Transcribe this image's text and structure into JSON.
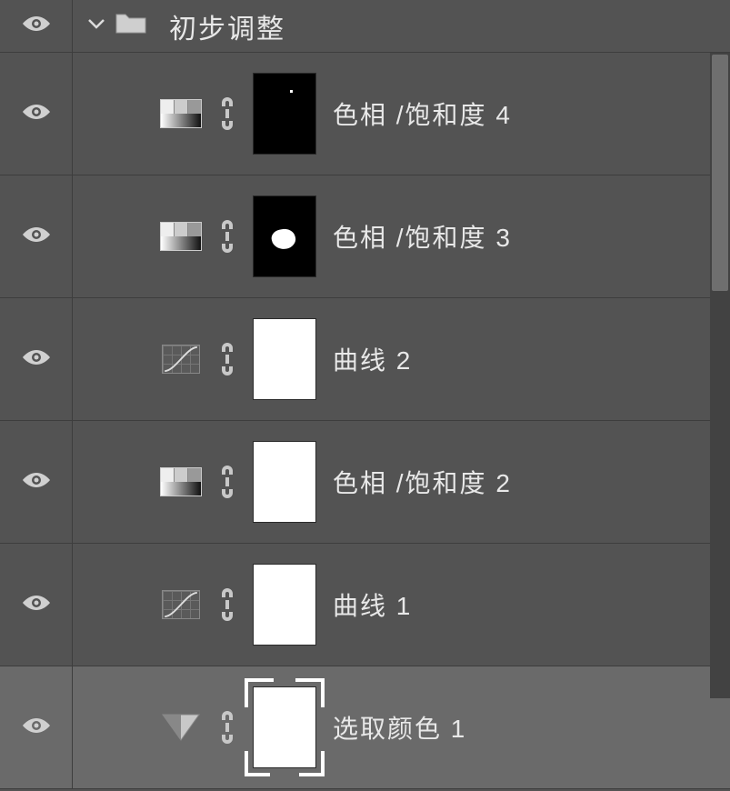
{
  "group": {
    "label": "初步调整",
    "expanded": true
  },
  "layers": [
    {
      "name": "色相 /饱和度 4",
      "type": "huesat",
      "mask": "black-dot",
      "selected": false
    },
    {
      "name": "色相 /饱和度 3",
      "type": "huesat",
      "mask": "black-blob",
      "selected": false
    },
    {
      "name": "曲线 2",
      "type": "curves",
      "mask": "white",
      "selected": false
    },
    {
      "name": "色相 /饱和度 2",
      "type": "huesat",
      "mask": "white",
      "selected": false
    },
    {
      "name": "曲线 1",
      "type": "curves",
      "mask": "white",
      "selected": false
    },
    {
      "name": "选取颜色 1",
      "type": "selcol",
      "mask": "white",
      "selected": true
    }
  ]
}
